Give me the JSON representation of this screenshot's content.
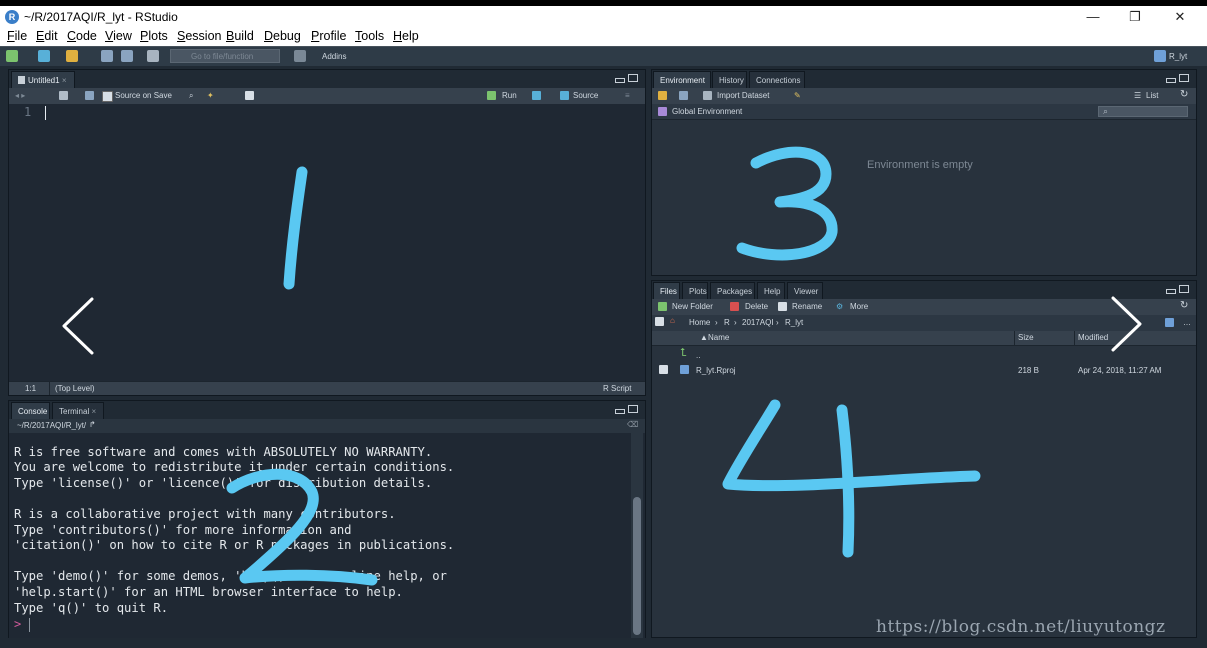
{
  "window": {
    "title": "~/R/2017AQI/R_lyt - RStudio",
    "logo_letter": "R",
    "minimize": "—",
    "restore": "❐",
    "close": "✕"
  },
  "menu": [
    "File",
    "Edit",
    "Code",
    "View",
    "Plots",
    "Session",
    "Build",
    "Debug",
    "Profile",
    "Tools",
    "Help"
  ],
  "toolbar": {
    "goto_placeholder": "Go to file/function",
    "addins": "Addins",
    "project": "R_lyt"
  },
  "source_pane": {
    "tab": "Untitled1",
    "source_on_save": "Source on Save",
    "run": "Run",
    "source": "Source",
    "line_number": "1",
    "status_pos": "1:1",
    "status_scope": "(Top Level)",
    "status_type": "R Script"
  },
  "console_pane": {
    "tabs": [
      "Console",
      "Terminal"
    ],
    "path": "~/R/2017AQI/R_lyt/",
    "lines": [
      "R is free software and comes with ABSOLUTELY NO WARRANTY.",
      "You are welcome to redistribute it under certain conditions.",
      "Type 'license()' or 'licence()' for distribution details.",
      "",
      "R is a collaborative project with many contributors.",
      "Type 'contributors()' for more information and",
      "'citation()' on how to cite R or R packages in publications.",
      "",
      "Type 'demo()' for some demos, 'help()' for on-line help, or",
      "'help.start()' for an HTML browser interface to help.",
      "Type 'q()' to quit R."
    ],
    "prompt": ">"
  },
  "env_pane": {
    "tabs": [
      "Environment",
      "History",
      "Connections"
    ],
    "import_dataset": "Import Dataset",
    "list": "List",
    "global_env": "Global Environment",
    "empty_msg": "Environment is empty"
  },
  "files_pane": {
    "tabs": [
      "Files",
      "Plots",
      "Packages",
      "Help",
      "Viewer"
    ],
    "new_folder": "New Folder",
    "delete": "Delete",
    "rename": "Rename",
    "more": "More",
    "breadcrumb": [
      "Home",
      "R",
      "2017AQI",
      "R_lyt"
    ],
    "columns": [
      "Name",
      "Size",
      "Modified"
    ],
    "up_label": "..",
    "rows": [
      {
        "name": "R_lyt.Rproj",
        "size": "218 B",
        "modified": "Apr 24, 2018, 11:27 AM"
      }
    ]
  },
  "annotations": [
    "1",
    "2",
    "3",
    "4"
  ],
  "watermark": "https://blog.csdn.net/liuyutongz",
  "colors": {
    "accent_blue": "#5ac8f2",
    "pane_bg": "#28323d",
    "toolbar_bg": "#2e3b47"
  }
}
